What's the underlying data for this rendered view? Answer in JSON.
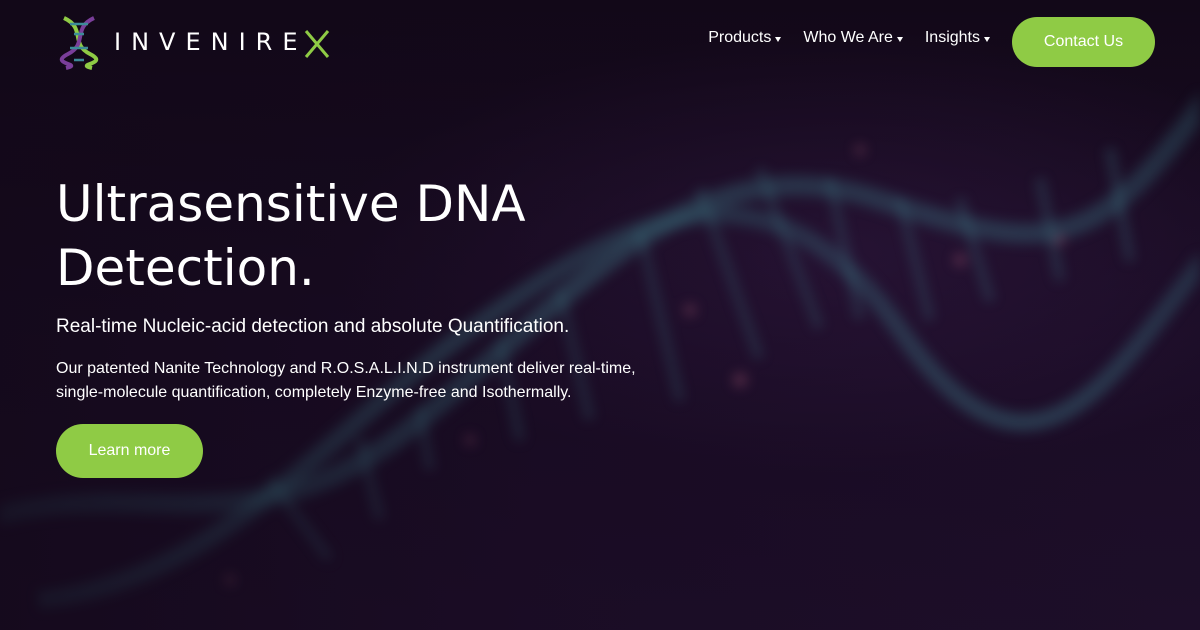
{
  "brand": {
    "wordmark": "INVENIRE",
    "wordmark_x": "X",
    "accent_color": "#8fcb45",
    "logo_icon": "dna-helix-icon"
  },
  "nav": {
    "items": [
      {
        "label": "Products",
        "icon": "caret-down-icon"
      },
      {
        "label": "Who We Are",
        "icon": "caret-down-icon"
      },
      {
        "label": "Insights",
        "icon": "caret-down-icon"
      }
    ],
    "cta_label": "Contact Us"
  },
  "hero": {
    "title": "Ultrasensitive DNA Detection.",
    "subtitle": "Real-time Nucleic-acid detection and absolute Quantification.",
    "description": "Our patented Nanite Technology and R.O.S.A.L.I.N.D instrument deliver real-time, single-molecule quantification, completely Enzyme-free and Isothermally.",
    "button_label": "Learn more",
    "background_image": "dna-double-helix"
  }
}
